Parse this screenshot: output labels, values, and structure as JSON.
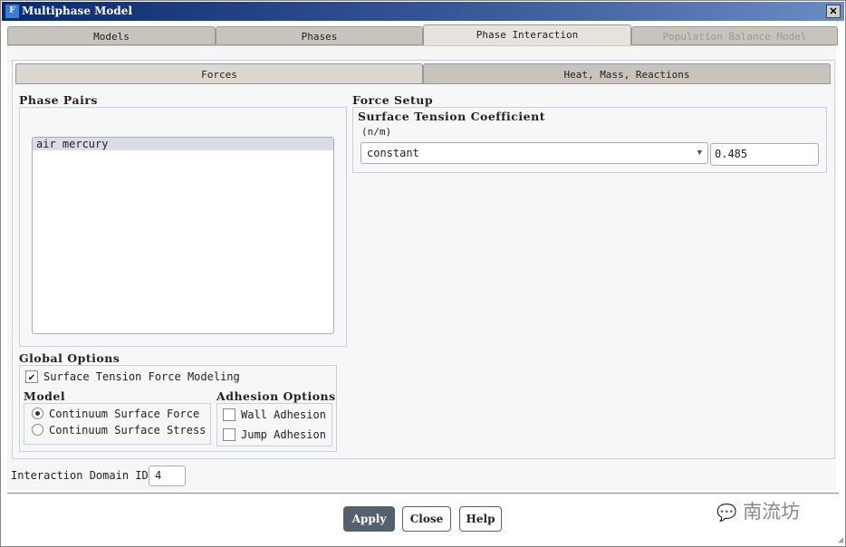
{
  "window": {
    "title": "Multiphase Model",
    "icon_letter": "F",
    "close": "✕"
  },
  "tabs": [
    {
      "label": "Models"
    },
    {
      "label": "Phases"
    },
    {
      "label": "Phase Interaction",
      "active": true
    },
    {
      "label": "Population Balance Model",
      "disabled": true
    }
  ],
  "subtabs": [
    {
      "label": "Forces",
      "active": true
    },
    {
      "label": "Heat, Mass, Reactions"
    }
  ],
  "phase_pairs": {
    "title": "Phase Pairs",
    "items": [
      "air mercury"
    ]
  },
  "force_setup": {
    "title": "Force Setup",
    "coef_title": "Surface Tension Coefficient",
    "unit": "(n/m)",
    "method": "constant",
    "value": "0.485"
  },
  "global_options": {
    "title": "Global Options",
    "surface_tension_label": "Surface Tension Force Modeling",
    "surface_tension_checked": true,
    "model_title": "Model",
    "models": [
      {
        "label": "Continuum Surface Force",
        "selected": true
      },
      {
        "label": "Continuum Surface Stress",
        "selected": false
      }
    ],
    "adhesion_title": "Adhesion Options",
    "wall_adhesion": "Wall Adhesion",
    "jump_adhesion": "Jump Adhesion"
  },
  "domain": {
    "label": "Interaction Domain ID",
    "value": "4"
  },
  "buttons": {
    "apply": "Apply",
    "close": "Close",
    "help": "Help"
  },
  "watermark": "南流坊"
}
